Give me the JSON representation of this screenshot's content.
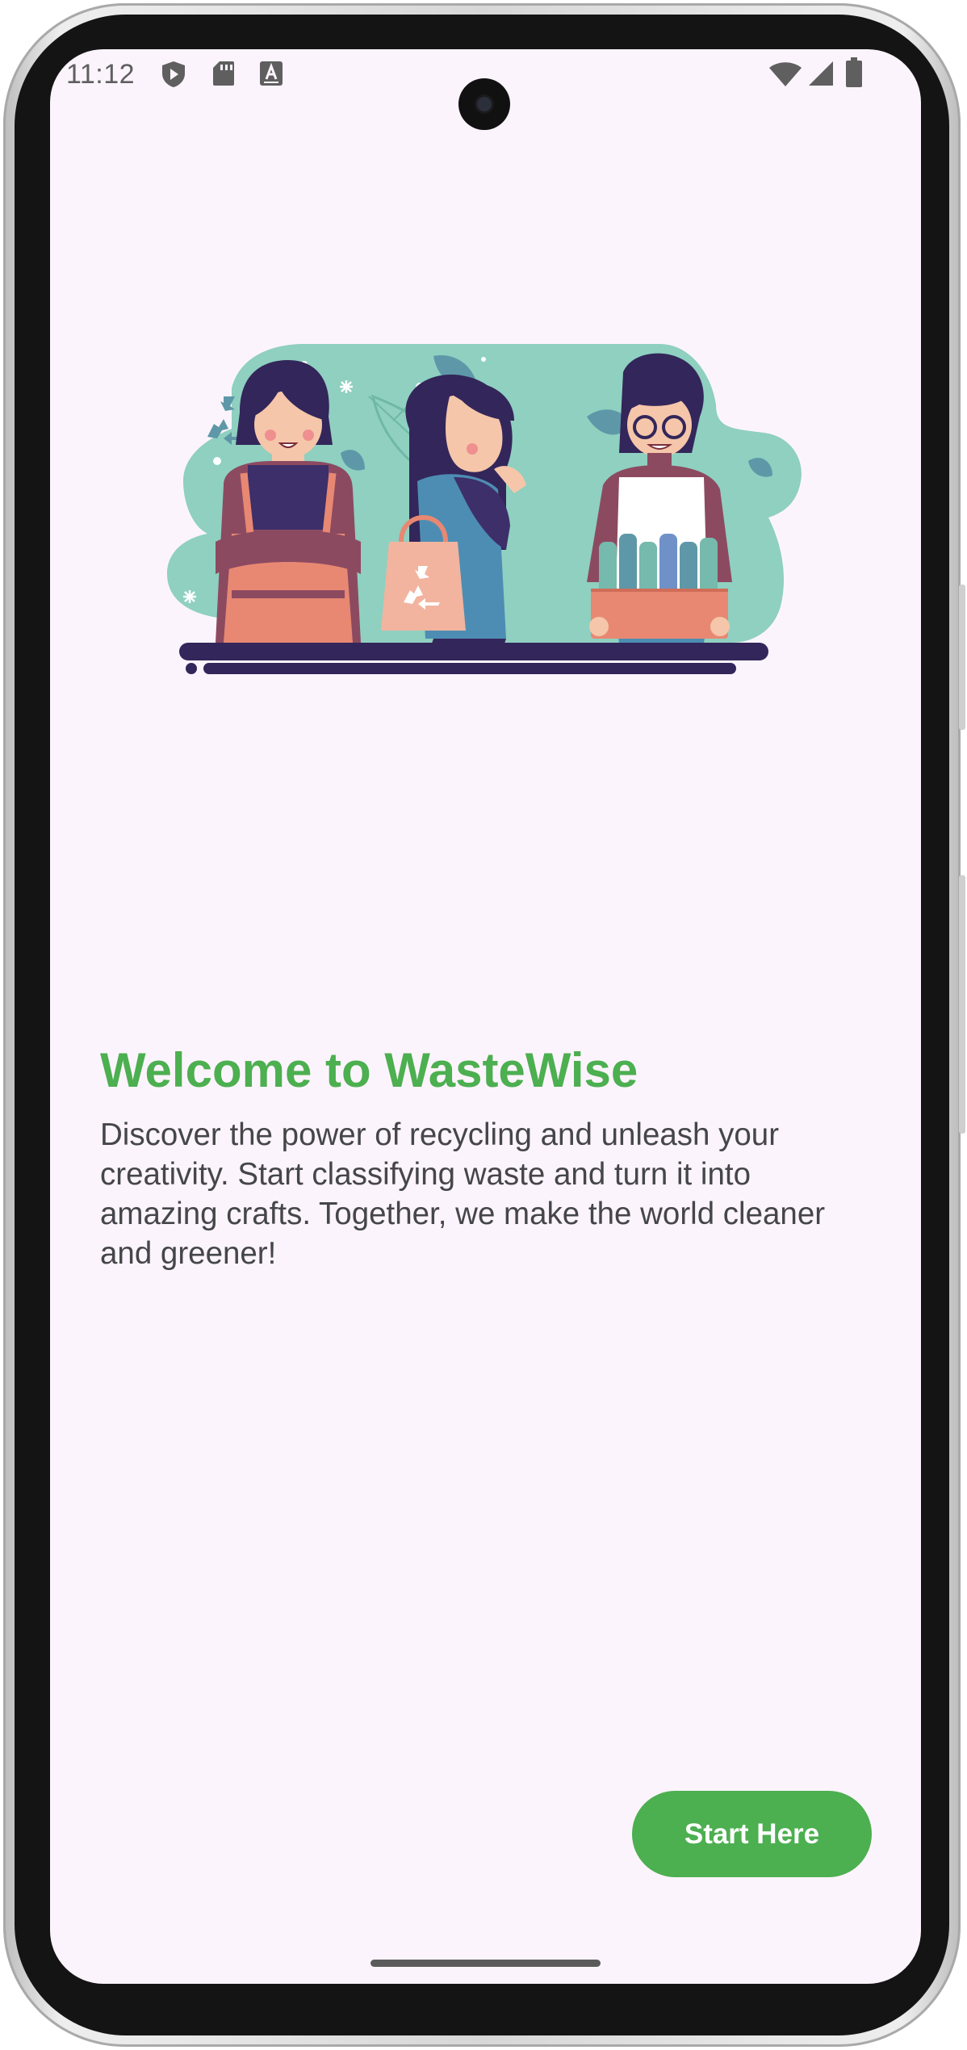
{
  "status_bar": {
    "time": "11:12",
    "left_icons": [
      "shield-play-icon",
      "sd-card-icon",
      "keyboard-a-icon"
    ],
    "right_icons": [
      "wifi-icon",
      "cell-signal-icon",
      "battery-icon"
    ]
  },
  "onboarding": {
    "illustration_icon": "people-recycling-illustration",
    "title": "Welcome to WasteWise",
    "description": "Discover the power of recycling and unleash your creativity. Start classifying waste and turn it into amazing crafts. Together, we make the world cleaner and greener!",
    "start_button_label": "Start Here"
  },
  "colors": {
    "accent": "#4caf50",
    "background": "#fcf4fc",
    "text": "#45464a",
    "illustration_teal": "#8fd0c0",
    "illustration_navy": "#33265a",
    "illustration_coral": "#e88872"
  }
}
